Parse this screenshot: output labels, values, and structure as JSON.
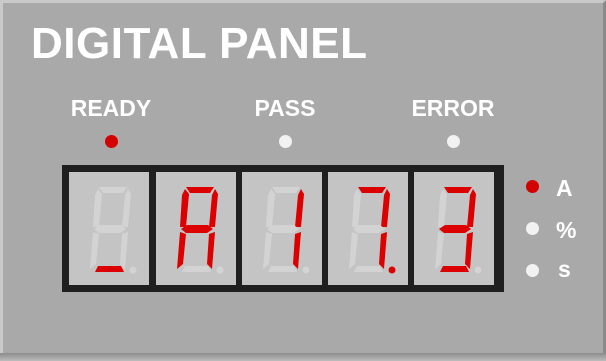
{
  "panel": {
    "title": "DIGITAL PANEL"
  },
  "status": [
    {
      "label": "READY",
      "active": true
    },
    {
      "label": "PASS",
      "active": false
    },
    {
      "label": "ERROR",
      "active": false
    }
  ],
  "display": {
    "digits": [
      {
        "segments": [
          "d"
        ],
        "dp": false
      },
      {
        "segments": [
          "a",
          "b",
          "c",
          "e",
          "f",
          "g"
        ],
        "dp": false
      },
      {
        "segments": [
          "b",
          "c"
        ],
        "dp": false
      },
      {
        "segments": [
          "a",
          "b",
          "c"
        ],
        "dp": true
      },
      {
        "segments": [
          "a",
          "b",
          "c",
          "d",
          "g"
        ],
        "dp": false
      }
    ],
    "readout": "_A17.3"
  },
  "units": [
    {
      "label": "A",
      "active": true
    },
    {
      "label": "%",
      "active": false
    },
    {
      "label": "s",
      "active": false
    }
  ],
  "colors": {
    "panel": "#a9a9a9",
    "frame": "#1f1f1f",
    "cell": "#c4c4c4",
    "segment_on": "#dc0000",
    "segment_off": "#d3d3d3",
    "led_on": "#d40000",
    "led_off": "#f2f2f2",
    "text": "#ffffff"
  }
}
